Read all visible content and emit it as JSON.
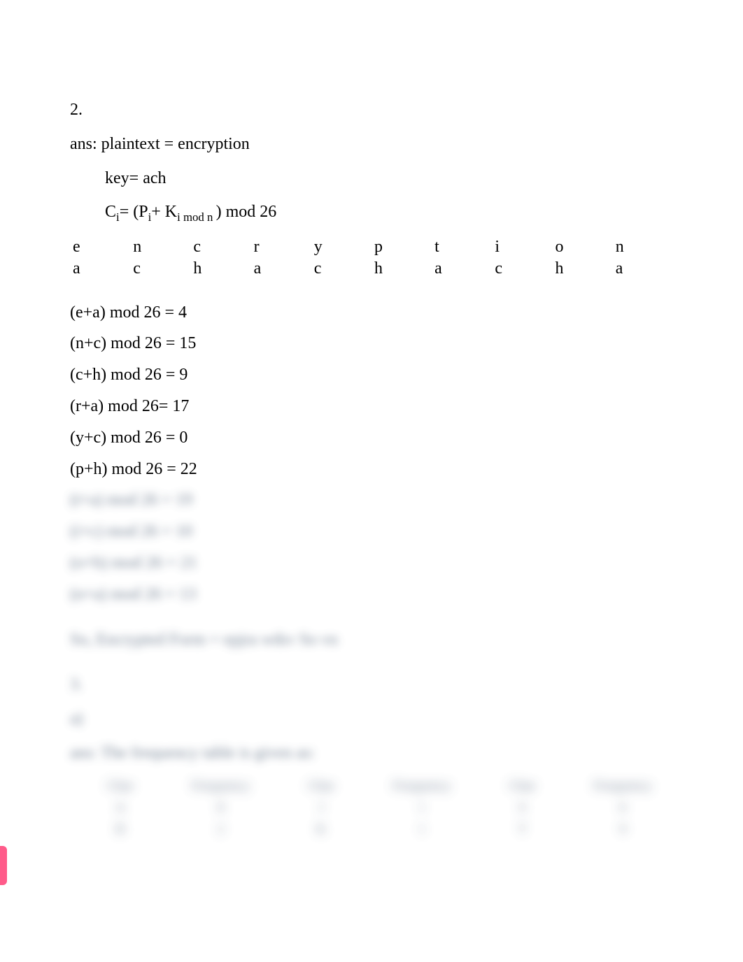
{
  "q_number": "2.",
  "ans_line": "ans: plaintext = encryption",
  "key_line": "key= ach",
  "formula_prefix": "C",
  "formula_sub1": "i",
  "formula_mid": "= (P",
  "formula_sub2": "i",
  "formula_mid2": "+ K",
  "formula_sub3": "i mod n ",
  "formula_suffix": ") mod 26",
  "cipher_table": {
    "row1": [
      "e",
      "n",
      "c",
      "r",
      "y",
      "p",
      "t",
      "i",
      "o",
      "n"
    ],
    "row2": [
      "a",
      "c",
      "h",
      "a",
      "c",
      "h",
      "a",
      "c",
      "h",
      "a"
    ]
  },
  "calc_lines": [
    "(e+a) mod 26 = 4",
    "(n+c) mod 26 = 15",
    "(c+h) mod 26 = 9",
    "(r+a) mod 26= 17",
    "(y+c) mod 26 = 0",
    "(p+h) mod 26 = 22"
  ],
  "blurred_calc_lines": [
    "(t+a) mod 26 = 19",
    "(i+c) mod 26 = 10",
    "(o+h) mod 26 = 21",
    "(n+a) mod 26 = 13"
  ],
  "blurred_result_line": "So, Encrypted Form = epjra wtkv  So  vn",
  "blurred_q3": "3.",
  "blurred_a": "a)",
  "blurred_freq_intro": "ans: The frequency table is given as:",
  "freq_table": {
    "headers": [
      "Char",
      "Frequency",
      "Char",
      "Frequency",
      "Char",
      "Frequency"
    ],
    "rows": [
      [
        "A",
        "8",
        "J",
        "1",
        "S",
        "6"
      ],
      [
        "B",
        "2",
        "K",
        "1",
        "T",
        "9"
      ]
    ]
  }
}
